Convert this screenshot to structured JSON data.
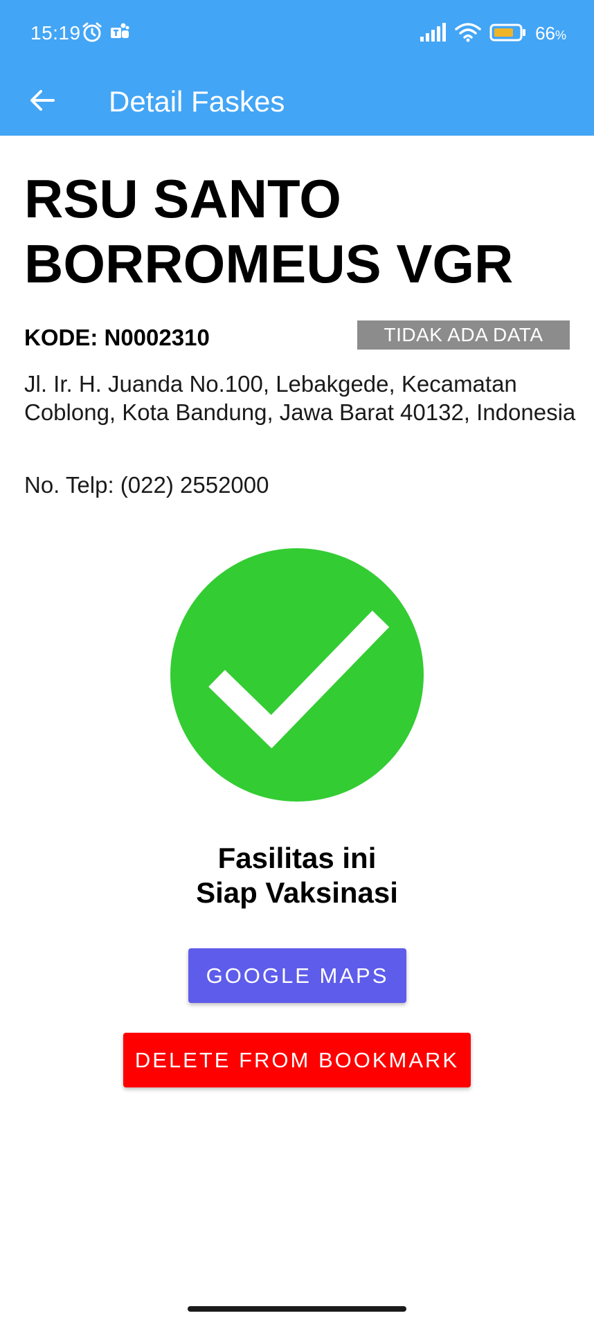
{
  "status_bar": {
    "time": "15:19",
    "battery_percent": "66",
    "battery_unit": "%",
    "icons": [
      "alarm-icon",
      "teams-icon",
      "signal-icon",
      "wifi-icon",
      "battery-icon"
    ]
  },
  "app_bar": {
    "title": "Detail Faskes",
    "back_icon": "arrow-left-icon"
  },
  "facility": {
    "name": "RSU SANTO BORROMEUS VGR",
    "code": "KODE: N0002310",
    "data_status": "TIDAK ADA DATA",
    "address": "Jl. Ir. H. Juanda No.100, Lebakgede, Kecamatan Coblong, Kota Bandung, Jawa Barat 40132, Indonesia",
    "phone": "No. Telp: (022) 2552000"
  },
  "vaccination": {
    "icon": "check-circle-icon",
    "line1": "Fasilitas ini",
    "line2": "Siap Vaksinasi"
  },
  "actions": {
    "maps_label": "GOOGLE MAPS",
    "delete_label": "DELETE FROM BOOKMARK"
  },
  "colors": {
    "app_bar": "#43a5f5",
    "success": "#33cc33",
    "maps_button": "#5e5ceb",
    "delete_button": "#ff0000",
    "chip": "#8c8c8c"
  }
}
